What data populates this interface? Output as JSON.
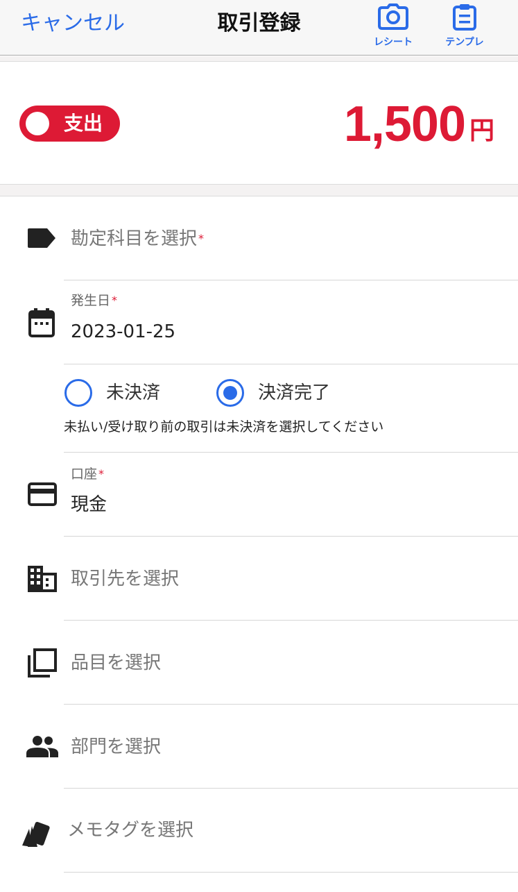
{
  "header": {
    "cancel_label": "キャンセル",
    "title": "取引登録",
    "receipt_label": "レシート",
    "template_label": "テンプレ"
  },
  "transaction": {
    "type_label": "支出",
    "amount": "1,500",
    "currency": "円"
  },
  "fields": {
    "account_item_placeholder": "勘定科目を選択",
    "date_label": "発生日",
    "date_value": "2023-01-25",
    "settlement_unpaid": "未決済",
    "settlement_done": "決済完了",
    "settlement_selected": "決済完了",
    "settlement_note": "未払い/受け取り前の取引は未決済を選択してください",
    "wallet_label": "口座",
    "wallet_value": "現金",
    "partner_placeholder": "取引先を選択",
    "item_placeholder": "品目を選択",
    "section_placeholder": "部門を選択",
    "memo_tag_placeholder": "メモタグを選択",
    "required_mark": "*"
  },
  "colors": {
    "accent": "#2a6be8",
    "expense": "#dd1a35"
  }
}
